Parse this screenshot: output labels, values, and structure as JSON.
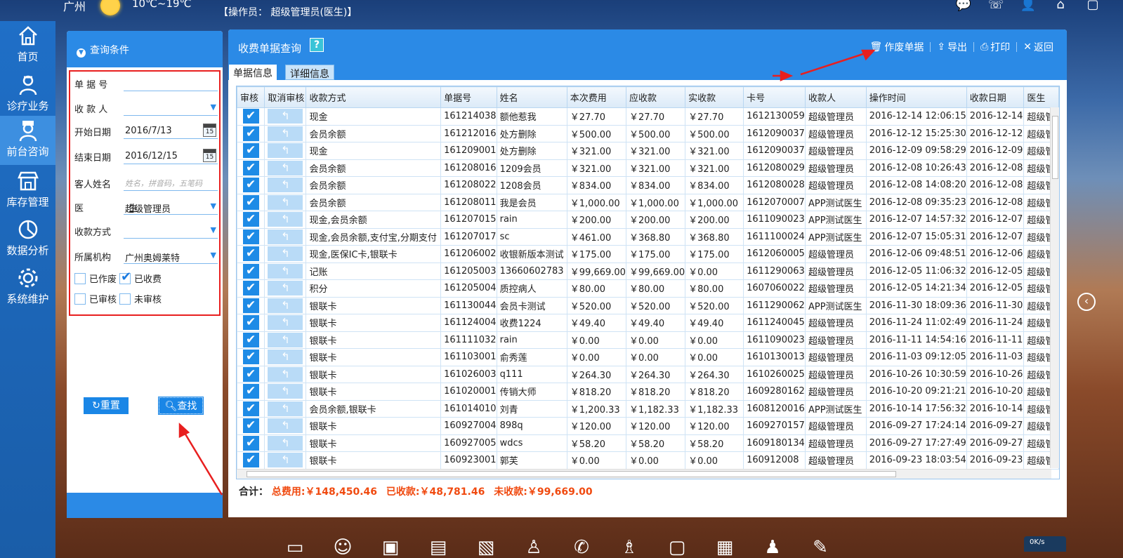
{
  "header": {
    "city": "广州",
    "temperature": "10℃~19℃",
    "operator": "【操作员： 超级管理员(医生)】"
  },
  "nav": {
    "items": [
      {
        "label": "首页"
      },
      {
        "label": "诊疗业务"
      },
      {
        "label": "前台咨询"
      },
      {
        "label": "库存管理"
      },
      {
        "label": "数据分析"
      },
      {
        "label": "系统维护"
      }
    ]
  },
  "query": {
    "title": "查询条件",
    "doc_no_label": "单 据 号",
    "payee_label": "收 款 人",
    "start_label": "开始日期",
    "start_value": "2016/7/13",
    "end_label": "结束日期",
    "end_value": "2016/12/15",
    "guest_label": "客人姓名",
    "guest_placeholder": "姓名，拼音码，五笔码",
    "doctor_label": "医 生",
    "doctor_value": "超级管理员",
    "paymethod_label": "收款方式",
    "org_label": "所属机构",
    "org_value": "广州奥姆莱特",
    "chk_voided": "已作废",
    "chk_paid": "已收费",
    "chk_audited": "已审核",
    "chk_unaudited": "未审核",
    "reset": "重置",
    "find": "查找"
  },
  "main": {
    "title": "收费单据查询",
    "help": "?",
    "toolbar": {
      "void": "作废单据",
      "export": "导出",
      "print": "打印",
      "back": "返回"
    },
    "tabs": [
      "单据信息",
      "详细信息"
    ],
    "columns": [
      "审核",
      "取消审核",
      "收款方式",
      "单据号",
      "姓名",
      "本次费用",
      "应收款",
      "实收款",
      "卡号",
      "收款人",
      "操作时间",
      "收款日期",
      "医生"
    ],
    "rows": [
      [
        "现金",
        "161214038",
        "额他惹我",
        "￥27.70",
        "￥27.70",
        "￥27.70",
        "1612130059",
        "超级管理员",
        "2016-12-14 12:06:15",
        "2016-12-14",
        "超级管"
      ],
      [
        "会员余额",
        "161212016",
        "处方删除",
        "￥500.00",
        "￥500.00",
        "￥500.00",
        "1612090037",
        "超级管理员",
        "2016-12-12 15:25:30",
        "2016-12-12",
        "超级管"
      ],
      [
        "现金",
        "161209001",
        "处方删除",
        "￥321.00",
        "￥321.00",
        "￥321.00",
        "1612090037",
        "超级管理员",
        "2016-12-09 09:58:29",
        "2016-12-09",
        "超级管"
      ],
      [
        "会员余额",
        "161208016",
        "1209会员",
        "￥321.00",
        "￥321.00",
        "￥321.00",
        "1612080029",
        "超级管理员",
        "2016-12-08 10:26:43",
        "2016-12-08",
        "超级管"
      ],
      [
        "会员余额",
        "161208022",
        "1208会员",
        "￥834.00",
        "￥834.00",
        "￥834.00",
        "1612080028",
        "超级管理员",
        "2016-12-08 14:08:20",
        "2016-12-08",
        "超级管"
      ],
      [
        "会员余额",
        "161208011",
        "我是会员",
        "￥1,000.00",
        "￥1,000.00",
        "￥1,000.00",
        "1612070007",
        "APP测试医生",
        "2016-12-08 09:35:23",
        "2016-12-08",
        "超级管"
      ],
      [
        "现金,会员余额",
        "161207015",
        "rain",
        "￥200.00",
        "￥200.00",
        "￥200.00",
        "1611090023",
        "APP测试医生",
        "2016-12-07 14:57:32",
        "2016-12-07",
        "超级管"
      ],
      [
        "现金,会员余额,支付宝,分期支付",
        "161207017",
        "sc",
        "￥461.00",
        "￥368.80",
        "￥368.80",
        "1611100024",
        "APP测试医生",
        "2016-12-07 15:05:31",
        "2016-12-07",
        "超级管"
      ],
      [
        "现金,医保IC卡,银联卡",
        "161206002",
        "收银新版本测试",
        "￥175.00",
        "￥175.00",
        "￥175.00",
        "1612060005",
        "超级管理员",
        "2016-12-06 09:48:51",
        "2016-12-06",
        "超级管"
      ],
      [
        "记账",
        "161205003",
        "13660602783",
        "￥99,669.00",
        "￥99,669.00",
        "￥0.00",
        "1611290063",
        "超级管理员",
        "2016-12-05 11:06:32",
        "2016-12-05",
        "超级管"
      ],
      [
        "积分",
        "161205004",
        "质控病人",
        "￥80.00",
        "￥80.00",
        "￥80.00",
        "1607060022",
        "超级管理员",
        "2016-12-05 14:21:34",
        "2016-12-05",
        "超级管"
      ],
      [
        "银联卡",
        "161130044",
        "会员卡测试",
        "￥520.00",
        "￥520.00",
        "￥520.00",
        "1611290062",
        "APP测试医生",
        "2016-11-30 18:09:36",
        "2016-11-30",
        "超级管"
      ],
      [
        "银联卡",
        "161124004",
        "收费1224",
        "￥49.40",
        "￥49.40",
        "￥49.40",
        "1611240045",
        "超级管理员",
        "2016-11-24 11:02:49",
        "2016-11-24",
        "超级管"
      ],
      [
        "银联卡",
        "161111032",
        "rain",
        "￥0.00",
        "￥0.00",
        "￥0.00",
        "1611090023",
        "超级管理员",
        "2016-11-11 14:54:16",
        "2016-11-11",
        "超级管"
      ],
      [
        "银联卡",
        "161103001",
        "俞秀莲",
        "￥0.00",
        "￥0.00",
        "￥0.00",
        "1610130013",
        "超级管理员",
        "2016-11-03 09:12:05",
        "2016-11-03",
        "超级管"
      ],
      [
        "银联卡",
        "161026003",
        "q111",
        "￥264.30",
        "￥264.30",
        "￥264.30",
        "1610260025",
        "超级管理员",
        "2016-10-26 10:30:59",
        "2016-10-26",
        "超级管"
      ],
      [
        "银联卡",
        "161020001",
        "传销大师",
        "￥818.20",
        "￥818.20",
        "￥818.20",
        "1609280162",
        "超级管理员",
        "2016-10-20 09:21:21",
        "2016-10-20",
        "超级管"
      ],
      [
        "会员余额,银联卡",
        "161014010",
        "刘青",
        "￥1,200.33",
        "￥1,182.33",
        "￥1,182.33",
        "1608120016",
        "APP测试医生",
        "2016-10-14 17:56:32",
        "2016-10-14",
        "超级管"
      ],
      [
        "银联卡",
        "160927004",
        "898q",
        "￥120.00",
        "￥120.00",
        "￥120.00",
        "1609270157",
        "超级管理员",
        "2016-09-27 17:24:14",
        "2016-09-27",
        "超级管"
      ],
      [
        "银联卡",
        "160927005",
        "wdcs",
        "￥58.20",
        "￥58.20",
        "￥58.20",
        "1609180134",
        "超级管理员",
        "2016-09-27 17:27:49",
        "2016-09-27",
        "超级管"
      ],
      [
        "银联卡",
        "160923001",
        "郭芙",
        "￥0.00",
        "￥0.00",
        "￥0.00",
        "160912008",
        "超级管理员",
        "2016-09-23 18:03:54",
        "2016-09-23",
        "超级管"
      ]
    ],
    "summary": {
      "label": "合计：",
      "total": "总费用:￥148,450.46",
      "received": "已收款:￥48,781.46",
      "unreceived": "未收款:￥99,669.00"
    }
  },
  "speed": "0K/s",
  "colors": {
    "primary": "#2b8ae6",
    "highlight_border": "#e81f1f",
    "summary_value": "#f04a10"
  }
}
